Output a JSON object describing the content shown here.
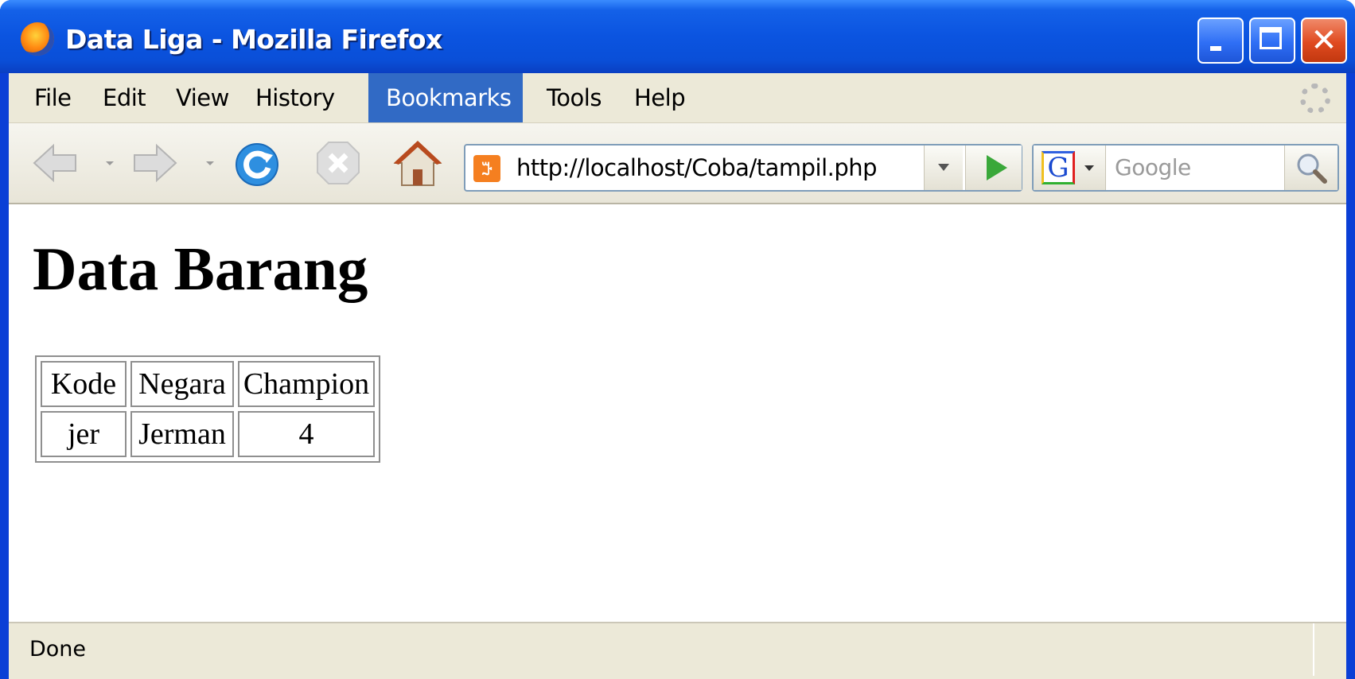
{
  "window": {
    "title": "Data Liga - Mozilla Firefox",
    "close_glyph": "✕"
  },
  "menu": {
    "items": [
      {
        "label": "File"
      },
      {
        "label": "Edit"
      },
      {
        "label": "View"
      },
      {
        "label": "History"
      },
      {
        "label": "Bookmarks",
        "state": "highlighted"
      },
      {
        "label": "Tools"
      },
      {
        "label": "Help"
      }
    ]
  },
  "toolbar": {
    "icons": [
      "back-icon",
      "forward-icon",
      "reload-icon",
      "stop-icon",
      "home-icon"
    ],
    "url": "http://localhost/Coba/tampil.php",
    "favicon_text": "ꔓ",
    "search_engine_glyph": "G",
    "search_placeholder": "Google"
  },
  "page": {
    "heading": "Data Barang",
    "table": {
      "header": [
        "Kode",
        "Negara",
        "Champion"
      ],
      "rows": [
        [
          "jer",
          "Jerman",
          "4"
        ]
      ]
    }
  },
  "status": {
    "text": "Done"
  },
  "colors": {
    "titlebar": "#0a4fd8",
    "menu_highlight": "#316ac5",
    "chrome": "#ece9d8"
  }
}
